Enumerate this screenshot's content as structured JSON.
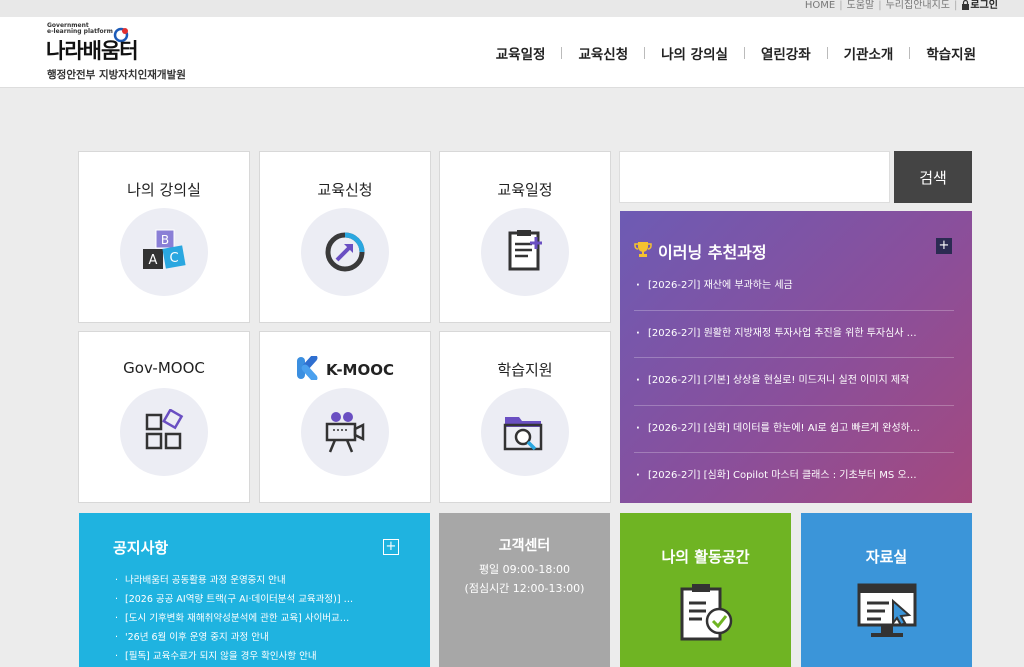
{
  "utility": {
    "links": [
      "HOME",
      "도움말",
      "누리집안내지도"
    ],
    "login": "로그인"
  },
  "header": {
    "logo_sub_line1": "Government",
    "logo_sub_line2": "e-learning platform",
    "logo_main": "나라배움터",
    "org": "행정안전부 지방자치인재개발원",
    "nav": [
      "교육일정",
      "교육신청",
      "나의 강의실",
      "열린강좌",
      "기관소개",
      "학습지원"
    ]
  },
  "tiles": [
    {
      "label": "나의 강의실",
      "icon": "abc-blocks-icon"
    },
    {
      "label": "교육신청",
      "icon": "progress-arrow-icon"
    },
    {
      "label": "교육일정",
      "icon": "schedule-document-icon"
    },
    {
      "label": "Gov-MOOC",
      "icon": "shapes-grid-icon"
    },
    {
      "label": "K-MOOC",
      "icon": "video-camera-icon"
    },
    {
      "label": "학습지원",
      "icon": "folder-search-icon"
    }
  ],
  "search": {
    "placeholder": "",
    "button": "검색"
  },
  "recommended": {
    "title": "이러닝 추천과정",
    "items": [
      "[2026-2기] 재산에 부과하는 세금",
      "[2026-2기] 원활한 지방재정 투자사업 추진을 위한 투자심사 …",
      "[2026-2기] [기본] 상상을 현실로! 미드저니 실전 이미지 제작",
      "[2026-2기] [심화] 데이터를 한눈에! AI로 쉽고 빠르게 완성하…",
      "[2026-2기] [심화] Copilot 마스터 클래스 : 기초부터 MS 오…"
    ]
  },
  "notice": {
    "title": "공지사항",
    "items": [
      "나라배움터 공동활용 과정 운영중지 안내",
      "[2026 공공 AI역량 트랙(구 AI·데이터분석 교육과정)] …",
      "[도시 기후변화 재해취약성분석에 관한 교육] 사이버교…",
      "'26년 6월 이후 운영 중지 과정 안내",
      "[필독] 교육수료가 되지 않을 경우 확인사항 안내"
    ]
  },
  "customer_center": {
    "title": "고객센터",
    "hours": "평일 09:00-18:00",
    "lunch": "(점심시간 12:00-13:00)"
  },
  "activity": {
    "title": "나의 활동공간"
  },
  "library": {
    "title": "자료실"
  }
}
